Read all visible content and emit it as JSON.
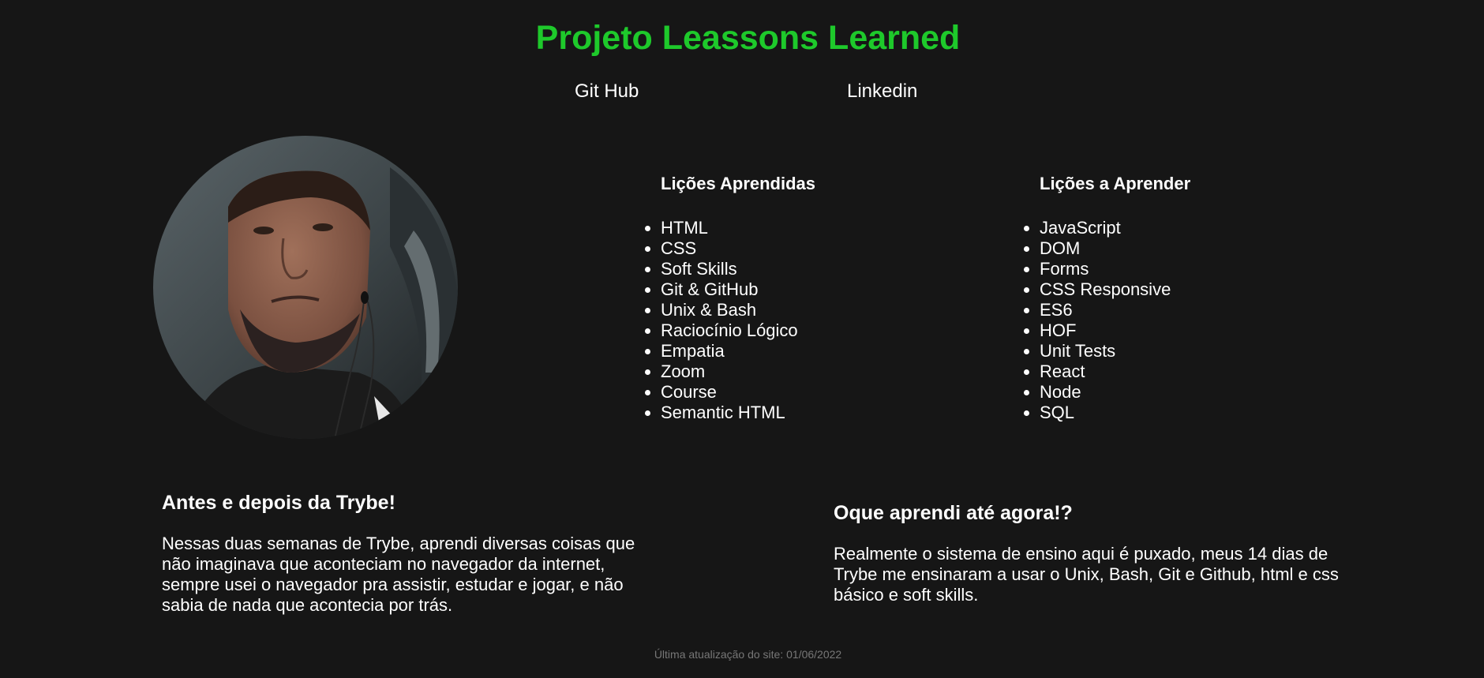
{
  "header": {
    "title": "Projeto Leassons Learned",
    "links": {
      "github": "Git Hub",
      "linkedin": "Linkedin"
    }
  },
  "lessons_learned": {
    "heading": "Lições Aprendidas",
    "items": [
      "HTML",
      "CSS",
      "Soft Skills",
      "Git & GitHub",
      "Unix & Bash",
      "Raciocínio Lógico",
      "Empatia",
      "Zoom",
      "Course",
      "Semantic HTML"
    ]
  },
  "lessons_to_learn": {
    "heading": "Lições a Aprender",
    "items": [
      "JavaScript",
      "DOM",
      "Forms",
      "CSS Responsive",
      "ES6",
      "HOF",
      "Unit Tests",
      "React",
      "Node",
      "SQL"
    ]
  },
  "before_after": {
    "heading": "Antes e depois da Trybe!",
    "text": "Nessas duas semanas de Trybe, aprendi diversas coisas que não imaginava que aconteciam no navegador da internet, sempre usei o navegador pra assistir, estudar e jogar, e não sabia de nada que acontecia por trás."
  },
  "learned_so_far": {
    "heading": "Oque aprendi até agora!?",
    "text": "Realmente o sistema de ensino aqui é puxado, meus 14 dias de Trybe me ensinaram a usar o Unix, Bash, Git e Github, html e css básico e soft skills."
  },
  "footer": {
    "text": "Última atualização do site: 01/06/2022"
  },
  "colors": {
    "background": "#161616",
    "title": "#1ec92b",
    "text": "#ffffff",
    "footer": "#777777"
  }
}
